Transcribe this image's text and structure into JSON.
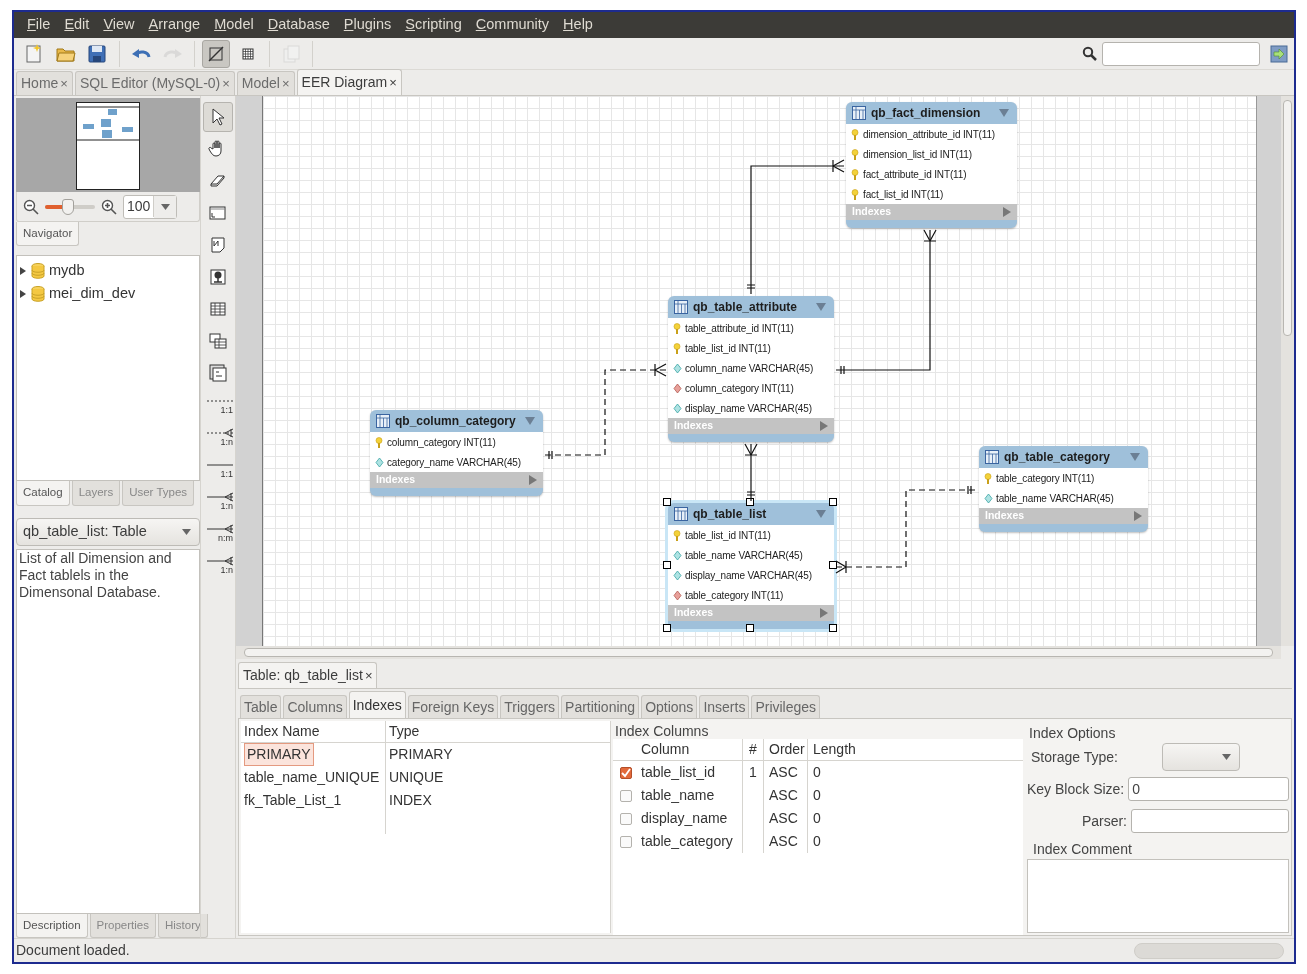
{
  "menu": [
    {
      "label": "File"
    },
    {
      "label": "Edit"
    },
    {
      "label": "View"
    },
    {
      "label": "Arrange"
    },
    {
      "label": "Model"
    },
    {
      "label": "Database"
    },
    {
      "label": "Plugins"
    },
    {
      "label": "Scripting"
    },
    {
      "label": "Community"
    },
    {
      "label": "Help"
    }
  ],
  "toolbar": [
    {
      "kind": "new"
    },
    {
      "kind": "open"
    },
    {
      "kind": "save"
    },
    {
      "kind": "undo",
      "disabled": false
    },
    {
      "kind": "redo",
      "disabled": true
    },
    {
      "kind": "toggle",
      "selected": true
    },
    {
      "kind": "grid",
      "selected": false
    },
    {
      "kind": "copy",
      "disabled": true
    }
  ],
  "doc_tabs": [
    {
      "label": "Home",
      "close": "×",
      "selected": false
    },
    {
      "label": "SQL Editor (MySQL-0)",
      "close": "×",
      "selected": false
    },
    {
      "label": "Model",
      "close": "×",
      "selected": false
    },
    {
      "label": "EER Diagram",
      "close": "×",
      "selected": true
    }
  ],
  "navigator": {
    "zoom": "100",
    "level": 0.45,
    "tab": "Navigator"
  },
  "catalog": [
    {
      "label": "mydb",
      "expanded": false
    },
    {
      "label": "mei_dim_dev",
      "expanded": false
    }
  ],
  "sidebar_tabs": [
    {
      "label": "Catalog",
      "selected": true
    },
    {
      "label": "Layers",
      "selected": false
    },
    {
      "label": "User Types",
      "selected": false
    }
  ],
  "description": {
    "object": "qb_table_list: Table",
    "text": "List of all Dimension and Fact tablels in the Dimensonal Database."
  },
  "description_tabs": [
    {
      "label": "Description",
      "selected": true
    },
    {
      "label": "Properties",
      "selected": false
    },
    {
      "label": "History",
      "selected": false
    }
  ],
  "palette": [
    {
      "kind": "pointer",
      "selected": true
    },
    {
      "kind": "hand",
      "selected": false
    },
    {
      "kind": "eraser",
      "selected": false
    },
    {
      "kind": "layer",
      "selected": false
    },
    {
      "kind": "note",
      "selected": false
    },
    {
      "kind": "image",
      "selected": false
    },
    {
      "kind": "table",
      "selected": false
    },
    {
      "kind": "view",
      "selected": false
    },
    {
      "kind": "routines",
      "selected": false
    },
    {
      "kind": "relation",
      "label": "1:1",
      "identifying": false,
      "many": false,
      "selected": false
    },
    {
      "kind": "relation",
      "label": "1:n",
      "identifying": false,
      "many": true,
      "selected": false
    },
    {
      "kind": "relation",
      "label": "1:1",
      "identifying": true,
      "many": false,
      "selected": false
    },
    {
      "kind": "relation",
      "label": "1:n",
      "identifying": true,
      "many": true,
      "selected": false
    },
    {
      "kind": "relation",
      "label": "n:m",
      "identifying": true,
      "many": true,
      "selected": false
    },
    {
      "kind": "relation",
      "label": "1:n",
      "identifying": true,
      "many": true,
      "selected": false
    }
  ],
  "diagram": {
    "tables": [
      {
        "name": "qb_fact_dimension",
        "selected": false,
        "footer": "Indexes",
        "columns": [
          {
            "text": "dimension_attribute_id INT(11)",
            "kind": "pk"
          },
          {
            "text": "dimension_list_id INT(11)",
            "kind": "pk"
          },
          {
            "text": "fact_attribute_id INT(11)",
            "kind": "pk"
          },
          {
            "text": "fact_list_id INT(11)",
            "kind": "pk"
          }
        ]
      },
      {
        "name": "qb_table_attribute",
        "selected": false,
        "footer": "Indexes",
        "columns": [
          {
            "text": "table_attribute_id INT(11)",
            "kind": "pk"
          },
          {
            "text": "table_list_id INT(11)",
            "kind": "pk"
          },
          {
            "text": "column_name VARCHAR(45)",
            "kind": "column"
          },
          {
            "text": "column_category INT(11)",
            "kind": "fk"
          },
          {
            "text": "display_name VARCHAR(45)",
            "kind": "column"
          }
        ]
      },
      {
        "name": "qb_column_category",
        "selected": false,
        "footer": "Indexes",
        "columns": [
          {
            "text": "column_category INT(11)",
            "kind": "pk"
          },
          {
            "text": "category_name VARCHAR(45)",
            "kind": "column"
          }
        ]
      },
      {
        "name": "qb_table_category",
        "selected": false,
        "footer": "Indexes",
        "columns": [
          {
            "text": "table_category INT(11)",
            "kind": "pk"
          },
          {
            "text": "table_name VARCHAR(45)",
            "kind": "column"
          }
        ]
      },
      {
        "name": "qb_table_list",
        "selected": true,
        "footer": "Indexes",
        "columns": [
          {
            "text": "table_list_id INT(11)",
            "kind": "pk"
          },
          {
            "text": "table_name VARCHAR(45)",
            "kind": "column"
          },
          {
            "text": "display_name VARCHAR(45)",
            "kind": "column"
          },
          {
            "text": "table_category INT(11)",
            "kind": "fk"
          }
        ]
      }
    ],
    "relationships": [
      {
        "identifying": true
      },
      {
        "identifying": true
      },
      {
        "identifying": false
      },
      {
        "identifying": true
      },
      {
        "identifying": false
      }
    ]
  },
  "editor": {
    "title": "Table: qb_table_list",
    "close": "×",
    "tabs": [
      {
        "label": "Table",
        "selected": false
      },
      {
        "label": "Columns",
        "selected": false
      },
      {
        "label": "Indexes",
        "selected": true
      },
      {
        "label": "Foreign Keys",
        "selected": false
      },
      {
        "label": "Triggers",
        "selected": false
      },
      {
        "label": "Partitioning",
        "selected": false
      },
      {
        "label": "Options",
        "selected": false
      },
      {
        "label": "Inserts",
        "selected": false
      },
      {
        "label": "Privileges",
        "selected": false
      }
    ],
    "indexes": {
      "columns": [
        "Index Name",
        "Type"
      ],
      "rows": [
        {
          "name": "PRIMARY",
          "type": "PRIMARY",
          "selected": true
        },
        {
          "name": "table_name_UNIQUE",
          "type": "UNIQUE",
          "selected": false
        },
        {
          "name": "fk_Table_List_1",
          "type": "INDEX",
          "selected": false
        }
      ]
    },
    "index_columns": {
      "title": "Index Columns",
      "columns": [
        "Column",
        "#",
        "Order",
        "Length"
      ],
      "rows": [
        {
          "checked": true,
          "column": "table_list_id",
          "number": "1",
          "order": "ASC",
          "length": "0"
        },
        {
          "checked": false,
          "column": "table_name",
          "order": "ASC",
          "length": "0"
        },
        {
          "checked": false,
          "column": "display_name",
          "order": "ASC",
          "length": "0"
        },
        {
          "checked": false,
          "column": "table_category",
          "order": "ASC",
          "length": "0"
        }
      ]
    },
    "options": {
      "title": "Index Options",
      "storage_type_label": "Storage Type:",
      "key_block_size_label": "Key Block Size:",
      "key_block_size": "0",
      "parser_label": "Parser:",
      "comment_label": "Index Comment"
    }
  },
  "status_bar": "Document loaded."
}
